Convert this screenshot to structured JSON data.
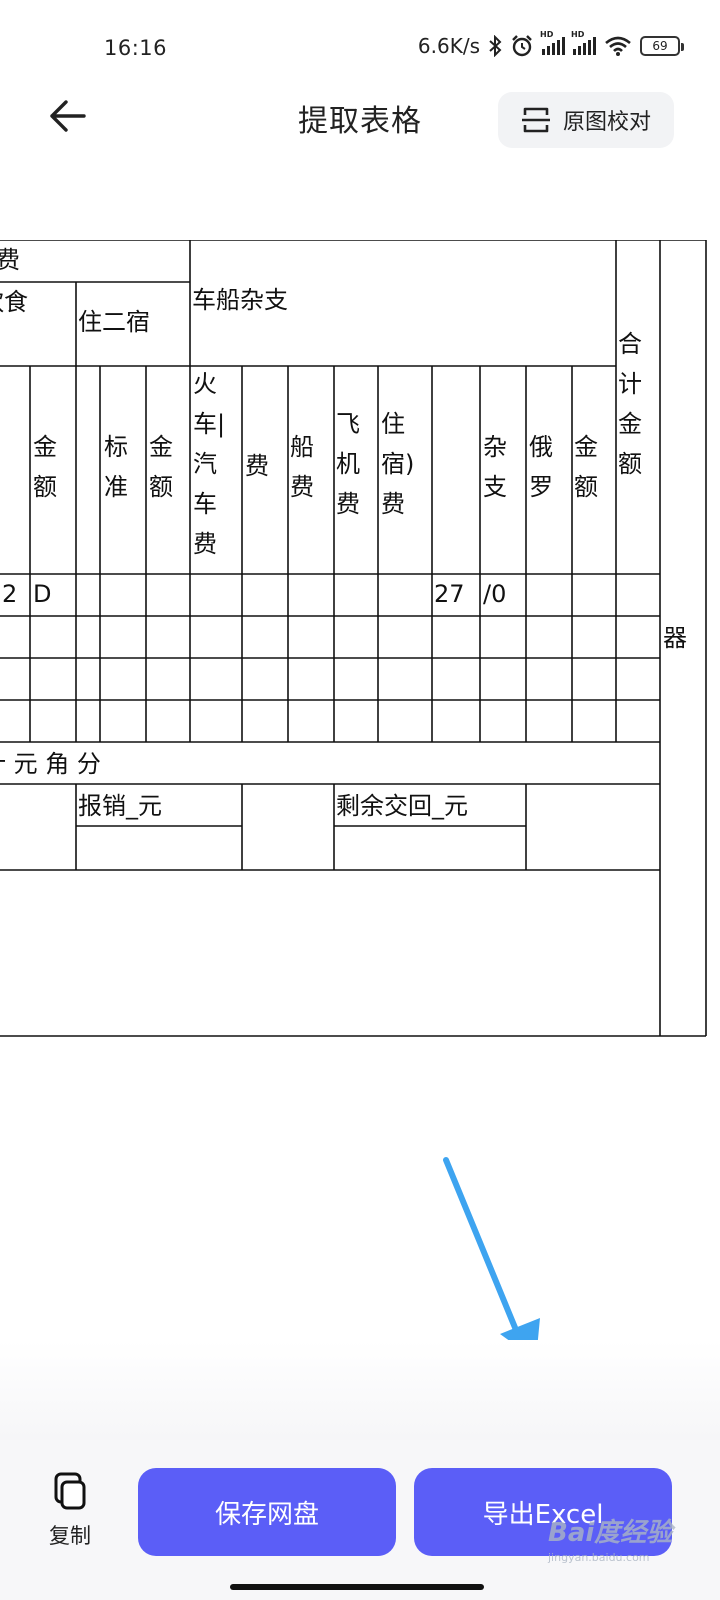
{
  "status_bar": {
    "time": "16:16",
    "net_speed": "6.6K/s",
    "battery": "69",
    "hd_label": "HD"
  },
  "header": {
    "title": "提取表格",
    "compare_label": "原图校对"
  },
  "table": {
    "h_fei": "费",
    "h_shi": "饮食",
    "h_zhu": "住二宿",
    "h_chechuan": "车船杂支",
    "h_heji": [
      "合",
      "计",
      "金",
      "额"
    ],
    "h_jin1": [
      "金",
      "额"
    ],
    "h_biao": [
      "标",
      "准"
    ],
    "h_jin2": [
      "金",
      "额"
    ],
    "h_huoche": [
      "火",
      "车|",
      "汽",
      "车",
      "费"
    ],
    "h_fei2": "费",
    "h_chuan": [
      "船",
      "费"
    ],
    "h_feiji": [
      "飞",
      "机",
      "费"
    ],
    "h_zhusu": [
      "住",
      "宿)",
      "费"
    ],
    "h_zazhi": [
      "杂",
      "支"
    ],
    "h_eluo": [
      "俄",
      "罗"
    ],
    "h_jin3": [
      "金",
      "额"
    ],
    "h_qi": "器",
    "r1": {
      "c0": "2",
      "c1": "D",
      "c10": "27",
      "c11": "/0"
    },
    "summary": "计 元 角 分",
    "baoxiao": "报销_元",
    "shengyu": "剩余交回_元"
  },
  "bottom": {
    "copy_label": "复制",
    "save_label": "保存网盘",
    "export_label": "导出Excel"
  },
  "watermark": {
    "main": "Bai度经验",
    "sub": "jingyan.baidu.com"
  },
  "colors": {
    "primary": "#5b5ef7",
    "arrow": "#3ea4f0",
    "background": "#ffffff",
    "bottom_bar": "#f7f7f9"
  }
}
